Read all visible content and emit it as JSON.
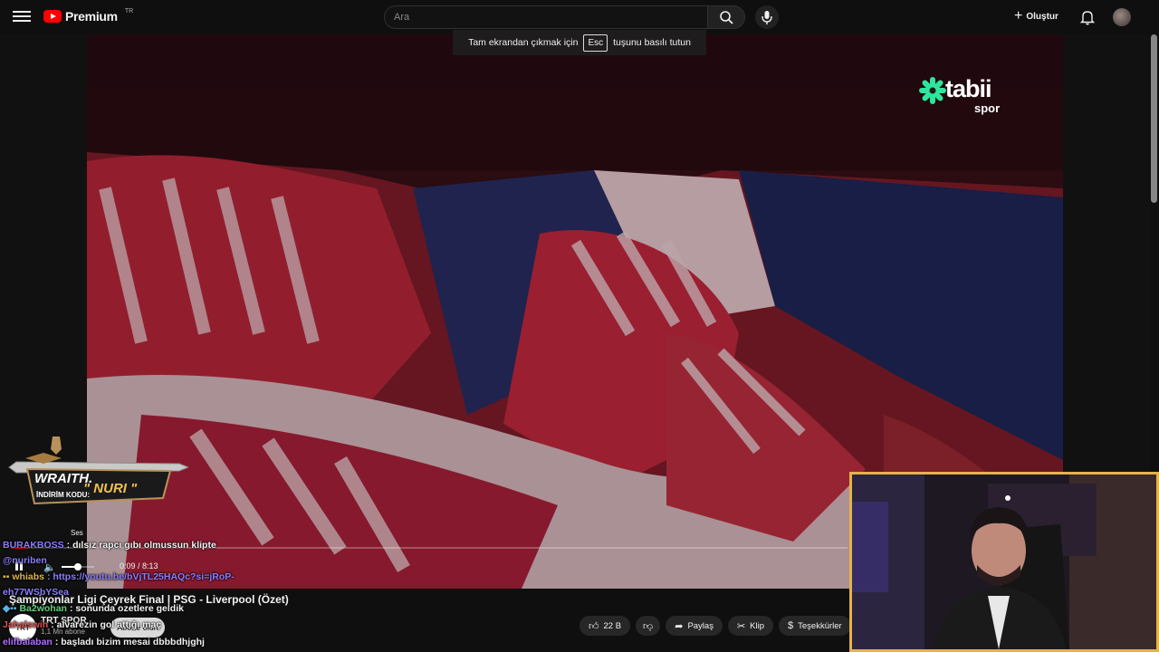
{
  "header": {
    "brand": "Premium",
    "region": "TR",
    "search_placeholder": "Ara",
    "create_label": "Oluştur",
    "colors": {
      "brand_red": "#ff0000",
      "background": "#0f0f0f"
    }
  },
  "esc_tip": {
    "before": "Tam ekrandan çıkmak için",
    "key": "Esc",
    "after": "tuşunu basılı tutun"
  },
  "overlay": {
    "tabii_word": "tabii",
    "tabii_sub": "spor",
    "sponsor_name": "WRAITH.",
    "sponsor_code_label": "İNDİRİM KODU:",
    "sponsor_code": "\" NURI \""
  },
  "player": {
    "volume_tooltip": "Ses",
    "time": "0:09 / 8:13",
    "progress": 0.018,
    "volume": 0.5
  },
  "video": {
    "title": "Şampiyonlar Ligi Çeyrek Final | PSG - Liverpool (Özet)",
    "channel": "TRT SPOR",
    "channel_avatar_text": "TRT",
    "subscribers": "1,1 Mn abone",
    "subscribe_label": "Abone olun",
    "likes": "22 B",
    "share_label": "Paylaş",
    "clip_label": "Klip",
    "thanks_label": "Teşekkürler"
  },
  "chat": [
    {
      "user": "BURAKBOSS",
      "color": "#8a7cff",
      "text": ": dılsız rapcı gıbı olmussun klipte"
    },
    {
      "user": "@nuriben",
      "color": "#8a7cff",
      "text": ""
    },
    {
      "user": "whiabs",
      "color": "#d9b44a",
      "text": ": https://youtu.be/bVjTL25HAQc?si=jRoP-"
    },
    {
      "user": "",
      "color": "#8a7cff",
      "text": "eh77WSbYSea"
    },
    {
      "user": "Ba2wohan",
      "color": "#5fd37a",
      "text": ": sonunda ozetlere geldik"
    },
    {
      "user": "Jahalswin",
      "color": "#e05050",
      "text": ": alvarezin gol attığı maç"
    },
    {
      "user": "elifbalaban",
      "color": "#b070ff",
      "text": ": başladı bizim mesai dbbbdhjghj"
    }
  ]
}
